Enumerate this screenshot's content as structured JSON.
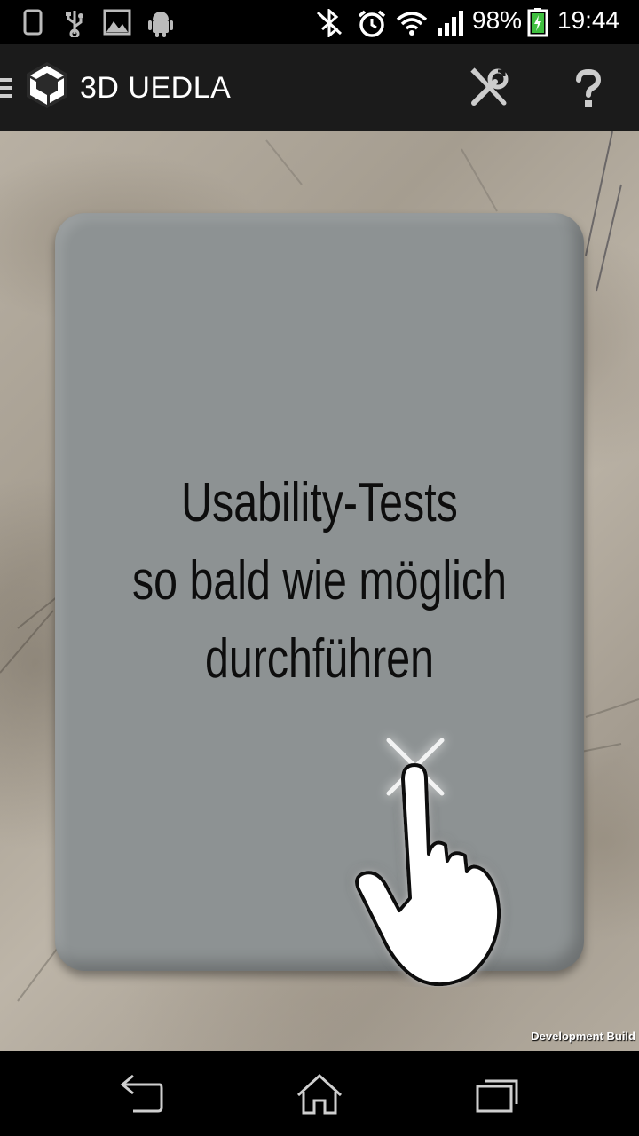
{
  "status_bar": {
    "battery_percent": "98%",
    "time": "19:44",
    "icons": [
      "phone-icon",
      "usb-icon",
      "image-icon",
      "android-icon",
      "bluetooth-off-icon",
      "alarm-icon",
      "wifi-icon",
      "signal-icon",
      "battery-charging-icon"
    ]
  },
  "action_bar": {
    "app_title": "3D UEDLA",
    "icons": [
      "menu-icon",
      "unity-logo-icon",
      "tools-icon",
      "help-icon"
    ]
  },
  "card": {
    "lines": [
      "Usability-Tests",
      "so bald wie möglich",
      "durchführen"
    ],
    "gesture_icon": "tap-hand-icon"
  },
  "overlay": {
    "dev_build": "Development Build"
  },
  "nav_bar": {
    "icons": [
      "back-icon",
      "home-icon",
      "recent-apps-icon"
    ]
  }
}
